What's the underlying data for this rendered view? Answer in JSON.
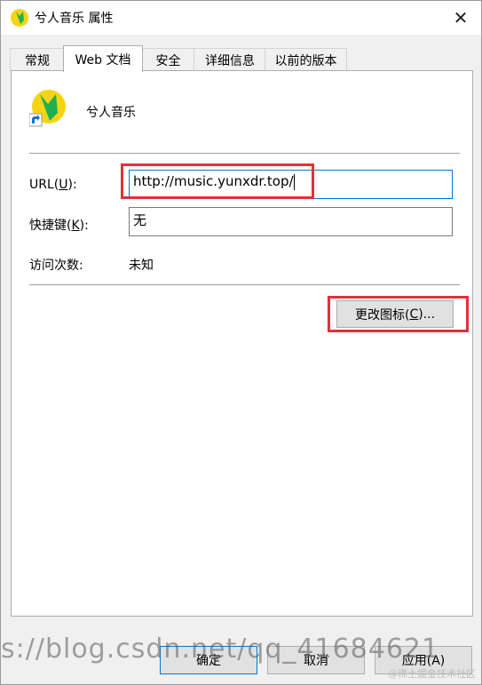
{
  "window": {
    "title": "兮人音乐 属性",
    "close_glyph": "✕"
  },
  "tabs": [
    {
      "label": "常规"
    },
    {
      "label": "Web 文档"
    },
    {
      "label": "安全"
    },
    {
      "label": "详细信息"
    },
    {
      "label": "以前的版本"
    }
  ],
  "app": {
    "name": "兮人音乐"
  },
  "fields": {
    "url": {
      "label_pre": "URL(",
      "label_key": "U",
      "label_post": "):",
      "value": "http://music.yunxdr.top/"
    },
    "shortcut": {
      "label_pre": "快捷键(",
      "label_key": "K",
      "label_post": "):",
      "value": "无"
    },
    "visits": {
      "label": "访问次数:",
      "value": "未知"
    }
  },
  "buttons": {
    "change_icon": {
      "pre": "更改图标(",
      "key": "C",
      "post": ")..."
    },
    "ok": "确定",
    "cancel": "取消",
    "apply": "应用(A)"
  },
  "watermark": {
    "text": "s://blog.csdn.net/qq_41684621",
    "corner": "@稀土掘金技术社区"
  },
  "colors": {
    "highlight": "#e0323a",
    "accent": "#0078d7",
    "icon_yellow": "#f5d416",
    "icon_green": "#1fb052"
  }
}
